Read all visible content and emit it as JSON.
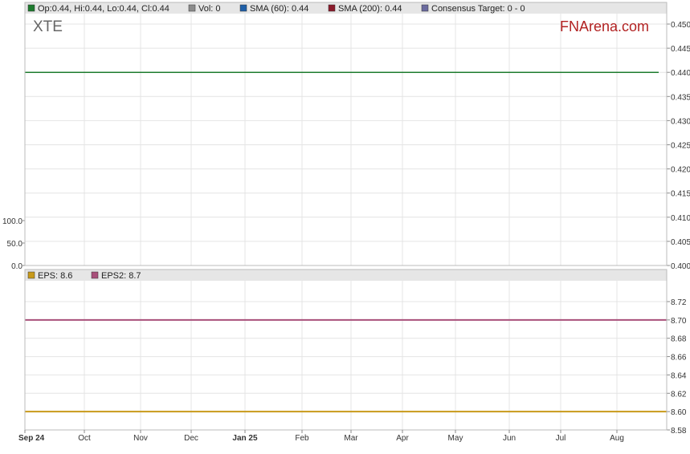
{
  "ticker": "XTE",
  "brand": {
    "text": "FNArena.com",
    "color": "#b22222"
  },
  "legend_top": [
    {
      "label": "Op:0.44, Hi:0.44, Lo:0.44, Cl:0.44",
      "color": "#1e7b2e"
    },
    {
      "label": "Vol: 0",
      "color": "#8c8c8c"
    },
    {
      "label": "SMA (60): 0.44",
      "color": "#1f5fa8"
    },
    {
      "label": "SMA (200): 0.44",
      "color": "#8b1a2b"
    },
    {
      "label": "Consensus Target: 0 - 0",
      "color": "#6a6a9e"
    }
  ],
  "legend_bottom": [
    {
      "label": "EPS: 8.6",
      "color": "#c89a1a"
    },
    {
      "label": "EPS2: 8.7",
      "color": "#a8507a"
    }
  ],
  "chart_data": [
    {
      "type": "line",
      "x": [
        "Sep 24",
        "Aug 25"
      ],
      "series": [
        {
          "name": "Cl",
          "values": [
            0.44,
            0.44
          ],
          "color": "#1e7b2e"
        }
      ],
      "ylim": [
        0.4,
        0.45
      ],
      "yticks": [
        "0.400",
        "0.405",
        "0.410",
        "0.415",
        "0.420",
        "0.425",
        "0.430",
        "0.435",
        "0.440",
        "0.445",
        "0.450"
      ],
      "volume_ylim": [
        0,
        100
      ],
      "volume_ticks": [
        "0.0",
        "50.0",
        "100.0"
      ],
      "grid": true
    },
    {
      "type": "line",
      "x": [
        "Sep 24",
        "Aug 25"
      ],
      "series": [
        {
          "name": "EPS",
          "values": [
            8.6,
            8.6
          ],
          "color": "#c89a1a"
        },
        {
          "name": "EPS2",
          "values": [
            8.7,
            8.7
          ],
          "color": "#a8507a"
        }
      ],
      "ylim": [
        8.58,
        8.72
      ],
      "yticks": [
        "8.58",
        "8.60",
        "8.62",
        "8.64",
        "8.66",
        "8.68",
        "8.70",
        "8.72"
      ],
      "xticks": [
        {
          "label": "Sep 24",
          "bold": true
        },
        {
          "label": "Oct",
          "bold": false
        },
        {
          "label": "Nov",
          "bold": false
        },
        {
          "label": "Dec",
          "bold": false
        },
        {
          "label": "Jan 25",
          "bold": true
        },
        {
          "label": "Feb",
          "bold": false
        },
        {
          "label": "Mar",
          "bold": false
        },
        {
          "label": "Apr",
          "bold": false
        },
        {
          "label": "May",
          "bold": false
        },
        {
          "label": "Jun",
          "bold": false
        },
        {
          "label": "Jul",
          "bold": false
        },
        {
          "label": "Aug",
          "bold": false
        }
      ],
      "grid": true
    }
  ]
}
